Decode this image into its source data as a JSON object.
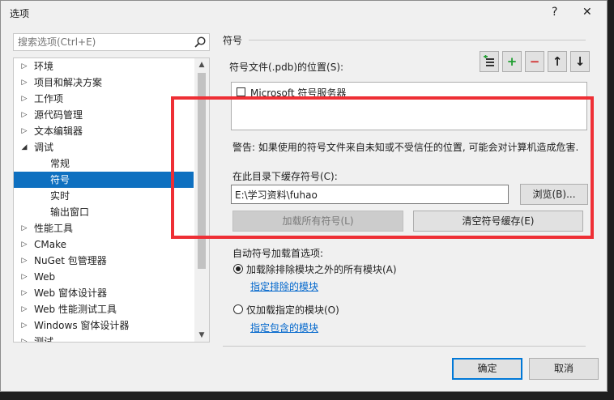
{
  "window": {
    "title": "选项",
    "help_glyph": "?",
    "close_glyph": "✕"
  },
  "search": {
    "placeholder": "搜索选项(Ctrl+E)"
  },
  "tree": {
    "items": [
      {
        "label": "环境",
        "level": 0,
        "state": "collapsed",
        "selected": false
      },
      {
        "label": "项目和解决方案",
        "level": 0,
        "state": "collapsed",
        "selected": false
      },
      {
        "label": "工作项",
        "level": 0,
        "state": "collapsed",
        "selected": false
      },
      {
        "label": "源代码管理",
        "level": 0,
        "state": "collapsed",
        "selected": false
      },
      {
        "label": "文本编辑器",
        "level": 0,
        "state": "collapsed",
        "selected": false
      },
      {
        "label": "调试",
        "level": 0,
        "state": "expanded",
        "selected": false
      },
      {
        "label": "常规",
        "level": 1,
        "state": "leaf",
        "selected": false
      },
      {
        "label": "符号",
        "level": 1,
        "state": "leaf",
        "selected": true
      },
      {
        "label": "实时",
        "level": 1,
        "state": "leaf",
        "selected": false
      },
      {
        "label": "输出窗口",
        "level": 1,
        "state": "leaf",
        "selected": false
      },
      {
        "label": "性能工具",
        "level": 0,
        "state": "collapsed",
        "selected": false
      },
      {
        "label": "CMake",
        "level": 0,
        "state": "collapsed",
        "selected": false
      },
      {
        "label": "NuGet 包管理器",
        "level": 0,
        "state": "collapsed",
        "selected": false
      },
      {
        "label": "Web",
        "level": 0,
        "state": "collapsed",
        "selected": false
      },
      {
        "label": "Web 窗体设计器",
        "level": 0,
        "state": "collapsed",
        "selected": false
      },
      {
        "label": "Web 性能测试工具",
        "level": 0,
        "state": "collapsed",
        "selected": false
      },
      {
        "label": "Windows 窗体设计器",
        "level": 0,
        "state": "collapsed",
        "selected": false
      },
      {
        "label": "测试",
        "level": 0,
        "state": "collapsed",
        "selected": false
      }
    ]
  },
  "symbols": {
    "section_title": "符号",
    "locations_label": "符号文件(.pdb)的位置(S):",
    "toolbar": [
      {
        "name": "new-location-button",
        "glyph": "≡"
      },
      {
        "name": "add-button",
        "glyph": "+"
      },
      {
        "name": "remove-button",
        "glyph": "−"
      },
      {
        "name": "move-up-button",
        "glyph": "↑"
      },
      {
        "name": "move-down-button",
        "glyph": "↓"
      }
    ],
    "servers": [
      {
        "label": "Microsoft 符号服务器",
        "checked": false
      }
    ],
    "warning": "警告: 如果使用的符号文件来自未知或不受信任的位置, 可能会对计算机造成危害.",
    "cache_label": "在此目录下缓存符号(C):",
    "cache_path": "E:\\学习资料\\fuhao",
    "browse_label": "浏览(B)...",
    "load_all_label": "加载所有符号(L)",
    "clear_cache_label": "清空符号缓存(E)",
    "auto_load_label": "自动符号加载首选项:",
    "option_all_label": "加载除排除模块之外的所有模块(A)",
    "option_all_selected": true,
    "excluded_link": "指定排除的模块",
    "option_specified_label": "仅加载指定的模块(O)",
    "option_specified_selected": false,
    "included_link": "指定包含的模块"
  },
  "footer": {
    "ok_label": "确定",
    "cancel_label": "取消"
  },
  "colors": {
    "selection": "#0e70c0",
    "highlight_box": "#ee2f35",
    "link": "#0066cc",
    "add_icon": "#1e9e2f",
    "remove_icon": "#d22a2a"
  }
}
